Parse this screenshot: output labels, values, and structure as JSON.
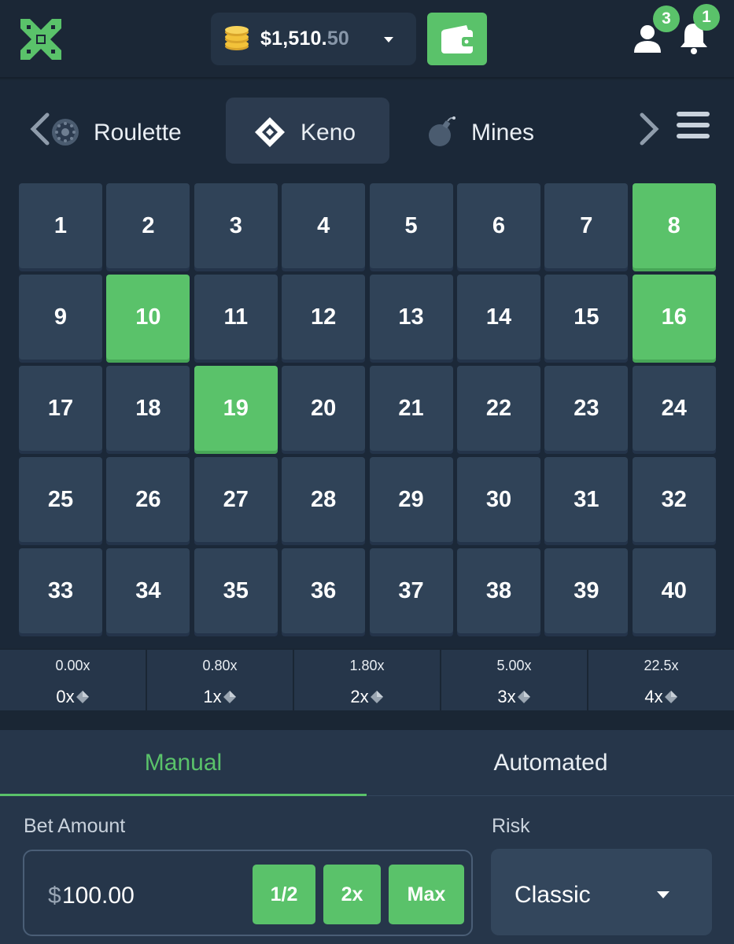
{
  "header": {
    "logo_icon": "crossed-swords-logo-icon",
    "balance": {
      "main": "$1,510.",
      "cents": "50"
    },
    "coin_icon": "coins-icon",
    "wallet_icon": "wallet-icon",
    "users_badge": "3",
    "notifications_badge": "1",
    "accent_color": "#5ac26a"
  },
  "games": {
    "tabs": [
      {
        "label": "Roulette",
        "icon": "roulette-wheel-icon"
      },
      {
        "label": "Keno",
        "icon": "keno-diamond-icon",
        "active": true
      },
      {
        "label": "Mines",
        "icon": "bomb-icon"
      }
    ]
  },
  "keno": {
    "numbers": [
      1,
      2,
      3,
      4,
      5,
      6,
      7,
      8,
      9,
      10,
      11,
      12,
      13,
      14,
      15,
      16,
      17,
      18,
      19,
      20,
      21,
      22,
      23,
      24,
      25,
      26,
      27,
      28,
      29,
      30,
      31,
      32,
      33,
      34,
      35,
      36,
      37,
      38,
      39,
      40
    ],
    "selected": [
      8,
      10,
      16,
      19
    ]
  },
  "payouts": [
    {
      "multiplier": "0.00x",
      "hits": "0x"
    },
    {
      "multiplier": "0.80x",
      "hits": "1x"
    },
    {
      "multiplier": "1.80x",
      "hits": "2x"
    },
    {
      "multiplier": "5.00x",
      "hits": "3x"
    },
    {
      "multiplier": "22.5x",
      "hits": "4x"
    }
  ],
  "panel": {
    "modes": {
      "manual": "Manual",
      "automated": "Automated"
    },
    "bet_label": "Bet Amount",
    "bet_currency": "$",
    "bet_value": "100.00",
    "buttons": {
      "half": "1/2",
      "double": "2x",
      "max": "Max"
    },
    "risk_label": "Risk",
    "risk_value": "Classic"
  }
}
